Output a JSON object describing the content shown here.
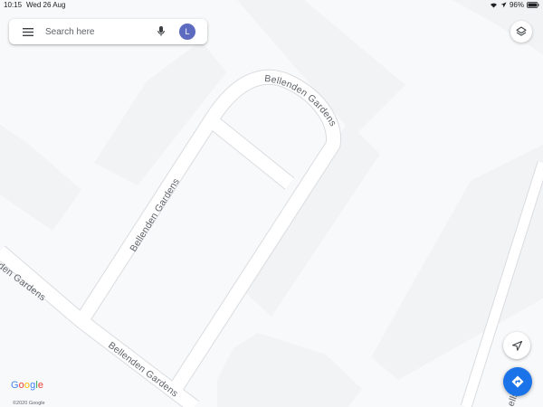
{
  "status_bar": {
    "time": "10:15",
    "date": "Wed 26 Aug",
    "battery": "96%"
  },
  "search": {
    "placeholder": "Search here",
    "avatar_initial": "L"
  },
  "streets": {
    "top_loop": "Bellenden Gardens",
    "west_side": "Bellenden Gardens",
    "south": "Bellenden Gardens",
    "left_edge": "den Gardens",
    "right_edge": "ellswoo"
  },
  "attribution": {
    "logo_letters": [
      "G",
      "o",
      "o",
      "g",
      "l",
      "e"
    ],
    "copyright": "©2020 Google"
  },
  "icons": {
    "menu": "hamburger-menu-icon",
    "mic": "microphone-icon",
    "layers": "layers-icon",
    "locate": "navigation-arrow-icon",
    "directions": "directions-diamond-icon",
    "wifi": "wifi-icon",
    "location": "location-arrow-icon",
    "battery": "battery-icon"
  },
  "colors": {
    "map_background": "#f8f9fa",
    "building": "#f1f3f4",
    "road_fill": "#ffffff",
    "road_casing": "#dadce0",
    "label": "#5f6368",
    "avatar": "#5c6bc0",
    "directions_button": "#1a73e8"
  }
}
